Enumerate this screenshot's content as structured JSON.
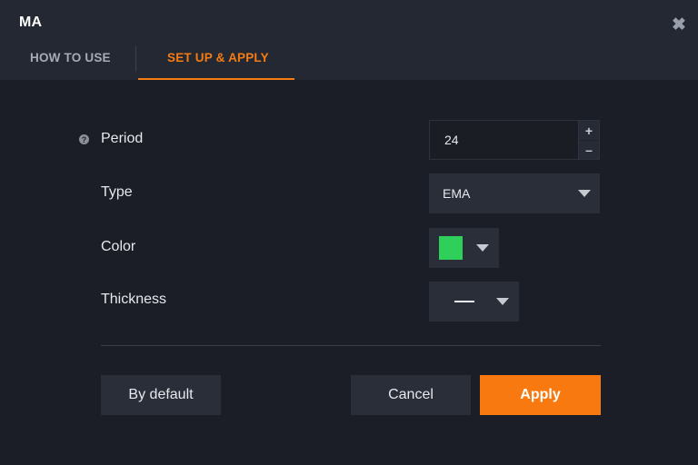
{
  "dialog": {
    "title": "MA",
    "close_icon": "close-icon"
  },
  "tabs": [
    {
      "label": "HOW TO USE",
      "active": false
    },
    {
      "label": "SET UP & APPLY",
      "active": true
    }
  ],
  "settings": {
    "period": {
      "label": "Period",
      "value": "24",
      "help_icon": "question-icon"
    },
    "type": {
      "label": "Type",
      "value": "EMA"
    },
    "color": {
      "label": "Color",
      "value": "#2fd05a"
    },
    "thickness": {
      "label": "Thickness"
    }
  },
  "buttons": {
    "default_label": "By default",
    "cancel_label": "Cancel",
    "apply_label": "Apply"
  },
  "colors": {
    "accent": "#f57c12",
    "apply_bg": "#f7790f",
    "background": "#1b1e26",
    "header_bg": "#242832"
  }
}
